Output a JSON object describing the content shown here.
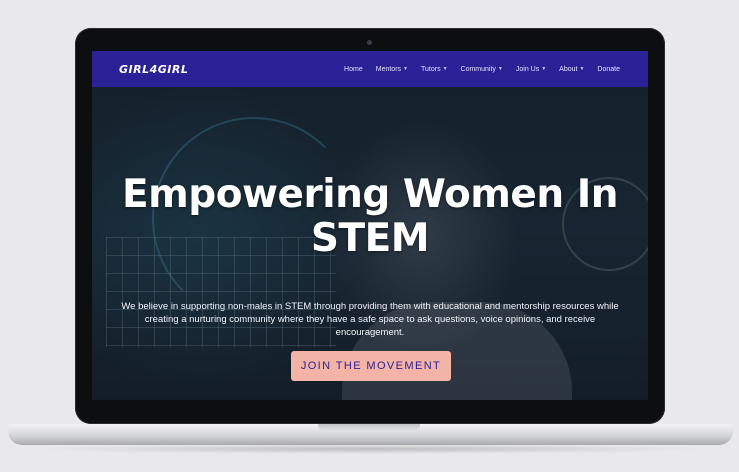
{
  "site": {
    "logo": "GIRL4GIRL"
  },
  "nav": {
    "items": [
      {
        "label": "Home",
        "dropdown": false
      },
      {
        "label": "Mentors",
        "dropdown": true
      },
      {
        "label": "Tutors",
        "dropdown": true
      },
      {
        "label": "Community",
        "dropdown": true
      },
      {
        "label": "Join Us",
        "dropdown": true
      },
      {
        "label": "About",
        "dropdown": true
      },
      {
        "label": "Donate",
        "dropdown": false
      }
    ]
  },
  "hero": {
    "title_line1": "Empowering Women In",
    "title_line2": "STEM",
    "subtitle": "We believe in supporting non-males in STEM through providing them with educational and mentorship resources while creating a nurturing community where they have a safe space to ask questions, voice opinions, and receive encouragement.",
    "cta_label": "JOIN THE MOVEMENT"
  },
  "colors": {
    "nav_bg": "#2b2196",
    "cta_bg": "#f3b3a6",
    "cta_text": "#2b2196"
  }
}
